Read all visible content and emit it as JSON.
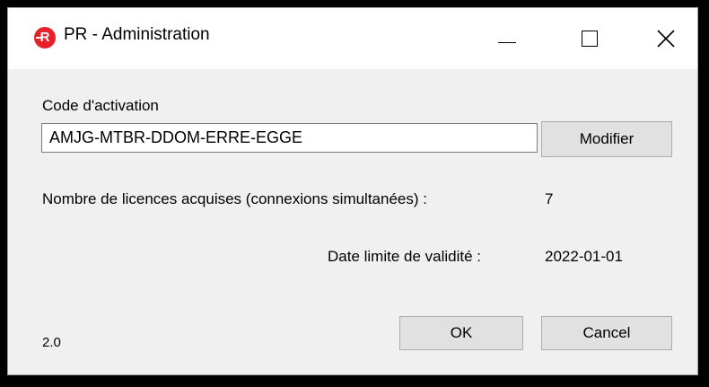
{
  "window": {
    "title": "PR - Administration",
    "icon_letter": "R"
  },
  "form": {
    "activation_label": "Code d'activation",
    "activation_code": "AMJG-MTBR-DDOM-ERRE-EGGE",
    "modify_label": "Modifier",
    "licences_label": "Nombre de licences acquises (connexions simultanées) :",
    "licences_value": "7",
    "validity_label": "Date limite de validité :",
    "validity_value": "2022-01-01"
  },
  "footer": {
    "version": "2.0",
    "ok_label": "OK",
    "cancel_label": "Cancel"
  }
}
